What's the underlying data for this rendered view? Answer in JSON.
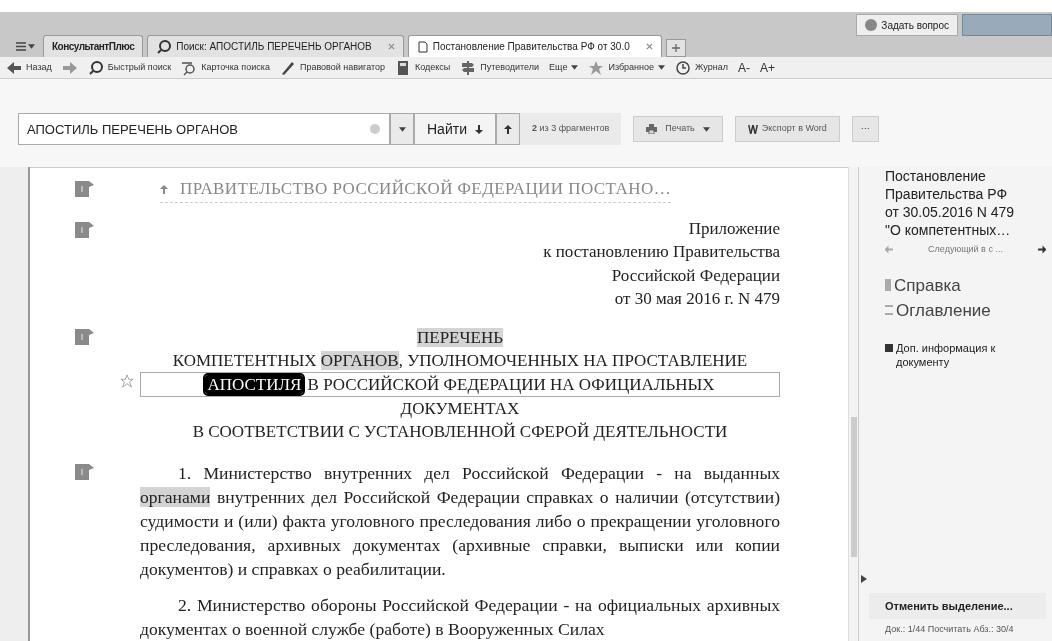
{
  "ask_button": "Задать вопрос",
  "tabs": [
    {
      "label": "КонсультантПлюс",
      "kind": "home",
      "selected": false
    },
    {
      "label": "Поиск: АПОСТИЛЬ ПЕРЕЧЕНЬ ОРГАНОВ",
      "kind": "search",
      "selected": false
    },
    {
      "label": "Постановление Правительства РФ от 30.0",
      "kind": "doc",
      "selected": true
    }
  ],
  "toolbar": [
    {
      "label": "Назад",
      "kind": "back"
    },
    {
      "kind": "forward"
    },
    {
      "label": "Быстрый поиск",
      "kind": "search"
    },
    {
      "label": "Карточка поиска",
      "kind": "card"
    },
    {
      "label": "Правовой навигатор",
      "kind": "nav"
    },
    {
      "label": "Кодексы",
      "kind": "book"
    },
    {
      "label": "Путеводители",
      "kind": "guide"
    },
    {
      "label": "Еще",
      "kind": "more"
    },
    {
      "label": "Избранное",
      "kind": "star"
    },
    {
      "label": "Журнал",
      "kind": "clock"
    },
    {
      "label": "A-",
      "kind": "text"
    },
    {
      "label": "A+",
      "kind": "text"
    }
  ],
  "search": {
    "value": "АПОСТИЛЬ ПЕРЕЧЕНЬ ОРГАНОВ",
    "find": "Найти",
    "count_bold": "2",
    "count": "из 3 фрагментов",
    "print": "Печать",
    "export": "Экспорт в Word",
    "more": "···"
  },
  "document": {
    "header": "ПРАВИТЕЛЬСТВО РОССИЙСКОЙ ФЕДЕРАЦИИ ПОСТАНО…",
    "appendix": [
      "Приложение",
      "к постановлению Правительства",
      "Российской Федерации",
      "от 30 мая 2016 г. N 479"
    ],
    "title_lines": [
      [
        {
          "text": "ПЕРЕЧЕНЬ",
          "match": true,
          "current": false
        }
      ],
      [
        {
          "text": "КОМПЕТЕНТНЫХ ",
          "match": false,
          "current": false
        },
        {
          "text": "ОРГАНОВ",
          "match": true,
          "current": false
        },
        {
          "text": ", УПОЛНОМОЧЕННЫХ НА ПРОСТАВЛЕНИЕ",
          "match": false,
          "current": false
        }
      ],
      [
        {
          "text": "АПОСТИЛЯ",
          "match": true,
          "current": true
        },
        {
          "text": " В РОССИЙСКОЙ ФЕДЕРАЦИИ НА ОФИЦИАЛЬНЫХ",
          "match": false,
          "current": false
        }
      ],
      [
        {
          "text": "ДОКУМЕНТАХ",
          "match": false,
          "current": false
        }
      ],
      [
        {
          "text": "В СООТВЕТСТВИИ С УСТАНОВЛЕННОЙ СФЕРОЙ ДЕЯТЕЛЬНОСТИ",
          "match": false,
          "current": false
        }
      ]
    ],
    "paragraphs": [
      [
        {
          "text": "1. Министерство внутренних дел Российской Федерации - на выданных ",
          "match": false,
          "current": false
        },
        {
          "text": "органами",
          "match": true,
          "current": false
        },
        {
          "text": " внутренних дел Российской Федерации справках о наличии (отсутствии) судимости и (или) факта уголовного преследования либо о прекращении уголовного преследования, архивных документах (архивные справки, выписки или копии документов) и справках о реабилитации.",
          "match": false,
          "current": false
        }
      ],
      [
        {
          "text": "2. Министерство обороны Российской Федерации - на официальных архивных документах о военной службе (работе) в Вооруженных Силах",
          "match": false,
          "current": false
        }
      ]
    ]
  },
  "side": {
    "title": [
      "Постановление",
      "Правительства РФ",
      "от 30.05.2016 N 479",
      "\"О компетентных…"
    ],
    "next": "Следующий в с ...",
    "links": [
      {
        "label": "Справка",
        "kind": "ref"
      },
      {
        "label": "Оглавление",
        "kind": "toc"
      }
    ],
    "info": "Доп. информация к документу",
    "cancel": "Отменить выделение...",
    "status": "Док.: 1/44 Посчитать Абз.: 30/4"
  }
}
